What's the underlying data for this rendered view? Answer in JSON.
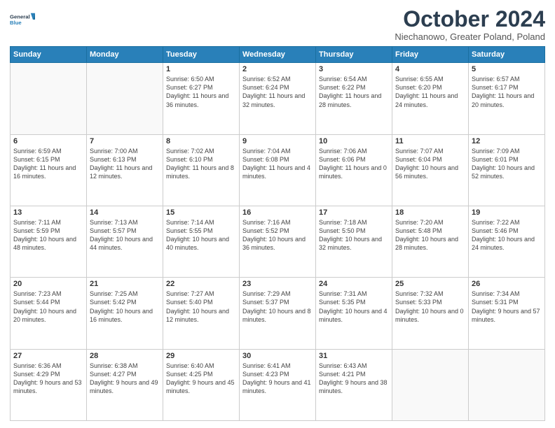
{
  "logo": {
    "line1": "General",
    "line2": "Blue"
  },
  "title": "October 2024",
  "subtitle": "Niechanowo, Greater Poland, Poland",
  "days_of_week": [
    "Sunday",
    "Monday",
    "Tuesday",
    "Wednesday",
    "Thursday",
    "Friday",
    "Saturday"
  ],
  "weeks": [
    [
      {
        "day": "",
        "sunrise": "",
        "sunset": "",
        "daylight": ""
      },
      {
        "day": "",
        "sunrise": "",
        "sunset": "",
        "daylight": ""
      },
      {
        "day": "1",
        "sunrise": "Sunrise: 6:50 AM",
        "sunset": "Sunset: 6:27 PM",
        "daylight": "Daylight: 11 hours and 36 minutes."
      },
      {
        "day": "2",
        "sunrise": "Sunrise: 6:52 AM",
        "sunset": "Sunset: 6:24 PM",
        "daylight": "Daylight: 11 hours and 32 minutes."
      },
      {
        "day": "3",
        "sunrise": "Sunrise: 6:54 AM",
        "sunset": "Sunset: 6:22 PM",
        "daylight": "Daylight: 11 hours and 28 minutes."
      },
      {
        "day": "4",
        "sunrise": "Sunrise: 6:55 AM",
        "sunset": "Sunset: 6:20 PM",
        "daylight": "Daylight: 11 hours and 24 minutes."
      },
      {
        "day": "5",
        "sunrise": "Sunrise: 6:57 AM",
        "sunset": "Sunset: 6:17 PM",
        "daylight": "Daylight: 11 hours and 20 minutes."
      }
    ],
    [
      {
        "day": "6",
        "sunrise": "Sunrise: 6:59 AM",
        "sunset": "Sunset: 6:15 PM",
        "daylight": "Daylight: 11 hours and 16 minutes."
      },
      {
        "day": "7",
        "sunrise": "Sunrise: 7:00 AM",
        "sunset": "Sunset: 6:13 PM",
        "daylight": "Daylight: 11 hours and 12 minutes."
      },
      {
        "day": "8",
        "sunrise": "Sunrise: 7:02 AM",
        "sunset": "Sunset: 6:10 PM",
        "daylight": "Daylight: 11 hours and 8 minutes."
      },
      {
        "day": "9",
        "sunrise": "Sunrise: 7:04 AM",
        "sunset": "Sunset: 6:08 PM",
        "daylight": "Daylight: 11 hours and 4 minutes."
      },
      {
        "day": "10",
        "sunrise": "Sunrise: 7:06 AM",
        "sunset": "Sunset: 6:06 PM",
        "daylight": "Daylight: 11 hours and 0 minutes."
      },
      {
        "day": "11",
        "sunrise": "Sunrise: 7:07 AM",
        "sunset": "Sunset: 6:04 PM",
        "daylight": "Daylight: 10 hours and 56 minutes."
      },
      {
        "day": "12",
        "sunrise": "Sunrise: 7:09 AM",
        "sunset": "Sunset: 6:01 PM",
        "daylight": "Daylight: 10 hours and 52 minutes."
      }
    ],
    [
      {
        "day": "13",
        "sunrise": "Sunrise: 7:11 AM",
        "sunset": "Sunset: 5:59 PM",
        "daylight": "Daylight: 10 hours and 48 minutes."
      },
      {
        "day": "14",
        "sunrise": "Sunrise: 7:13 AM",
        "sunset": "Sunset: 5:57 PM",
        "daylight": "Daylight: 10 hours and 44 minutes."
      },
      {
        "day": "15",
        "sunrise": "Sunrise: 7:14 AM",
        "sunset": "Sunset: 5:55 PM",
        "daylight": "Daylight: 10 hours and 40 minutes."
      },
      {
        "day": "16",
        "sunrise": "Sunrise: 7:16 AM",
        "sunset": "Sunset: 5:52 PM",
        "daylight": "Daylight: 10 hours and 36 minutes."
      },
      {
        "day": "17",
        "sunrise": "Sunrise: 7:18 AM",
        "sunset": "Sunset: 5:50 PM",
        "daylight": "Daylight: 10 hours and 32 minutes."
      },
      {
        "day": "18",
        "sunrise": "Sunrise: 7:20 AM",
        "sunset": "Sunset: 5:48 PM",
        "daylight": "Daylight: 10 hours and 28 minutes."
      },
      {
        "day": "19",
        "sunrise": "Sunrise: 7:22 AM",
        "sunset": "Sunset: 5:46 PM",
        "daylight": "Daylight: 10 hours and 24 minutes."
      }
    ],
    [
      {
        "day": "20",
        "sunrise": "Sunrise: 7:23 AM",
        "sunset": "Sunset: 5:44 PM",
        "daylight": "Daylight: 10 hours and 20 minutes."
      },
      {
        "day": "21",
        "sunrise": "Sunrise: 7:25 AM",
        "sunset": "Sunset: 5:42 PM",
        "daylight": "Daylight: 10 hours and 16 minutes."
      },
      {
        "day": "22",
        "sunrise": "Sunrise: 7:27 AM",
        "sunset": "Sunset: 5:40 PM",
        "daylight": "Daylight: 10 hours and 12 minutes."
      },
      {
        "day": "23",
        "sunrise": "Sunrise: 7:29 AM",
        "sunset": "Sunset: 5:37 PM",
        "daylight": "Daylight: 10 hours and 8 minutes."
      },
      {
        "day": "24",
        "sunrise": "Sunrise: 7:31 AM",
        "sunset": "Sunset: 5:35 PM",
        "daylight": "Daylight: 10 hours and 4 minutes."
      },
      {
        "day": "25",
        "sunrise": "Sunrise: 7:32 AM",
        "sunset": "Sunset: 5:33 PM",
        "daylight": "Daylight: 10 hours and 0 minutes."
      },
      {
        "day": "26",
        "sunrise": "Sunrise: 7:34 AM",
        "sunset": "Sunset: 5:31 PM",
        "daylight": "Daylight: 9 hours and 57 minutes."
      }
    ],
    [
      {
        "day": "27",
        "sunrise": "Sunrise: 6:36 AM",
        "sunset": "Sunset: 4:29 PM",
        "daylight": "Daylight: 9 hours and 53 minutes."
      },
      {
        "day": "28",
        "sunrise": "Sunrise: 6:38 AM",
        "sunset": "Sunset: 4:27 PM",
        "daylight": "Daylight: 9 hours and 49 minutes."
      },
      {
        "day": "29",
        "sunrise": "Sunrise: 6:40 AM",
        "sunset": "Sunset: 4:25 PM",
        "daylight": "Daylight: 9 hours and 45 minutes."
      },
      {
        "day": "30",
        "sunrise": "Sunrise: 6:41 AM",
        "sunset": "Sunset: 4:23 PM",
        "daylight": "Daylight: 9 hours and 41 minutes."
      },
      {
        "day": "31",
        "sunrise": "Sunrise: 6:43 AM",
        "sunset": "Sunset: 4:21 PM",
        "daylight": "Daylight: 9 hours and 38 minutes."
      },
      {
        "day": "",
        "sunrise": "",
        "sunset": "",
        "daylight": ""
      },
      {
        "day": "",
        "sunrise": "",
        "sunset": "",
        "daylight": ""
      }
    ]
  ]
}
